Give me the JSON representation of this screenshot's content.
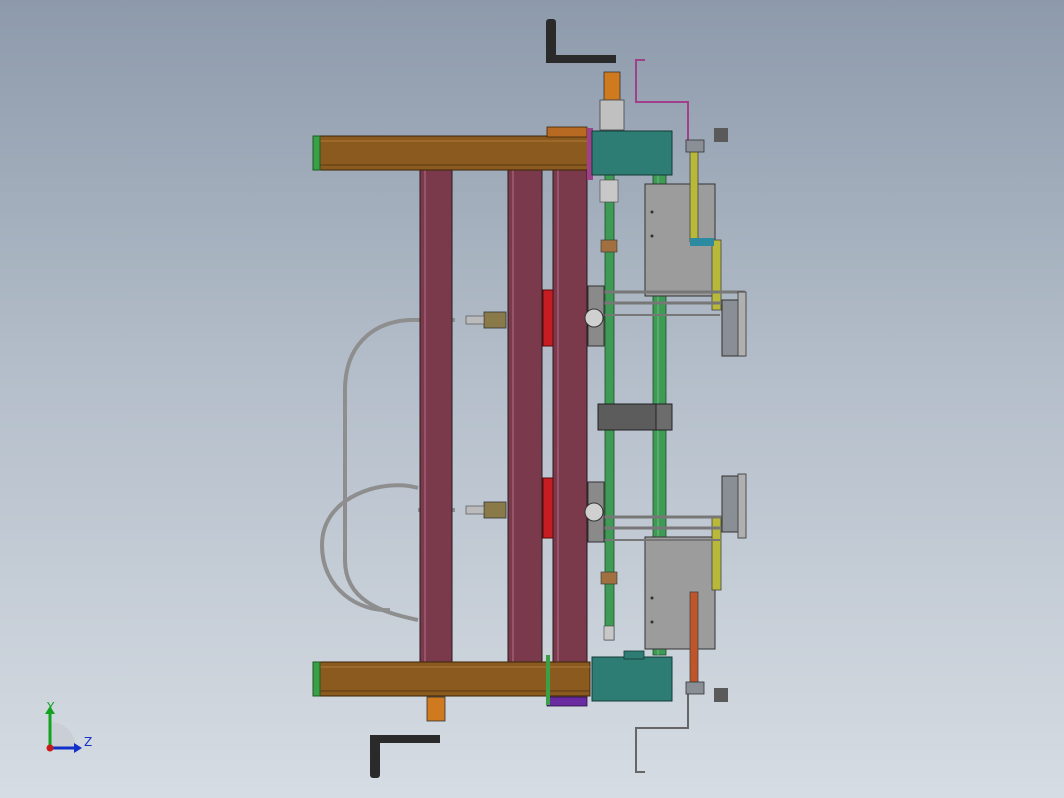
{
  "viewport": {
    "background_top": "#8d9aab",
    "background_bottom": "#d6dce3"
  },
  "colors": {
    "frame_beam": "#8b5a1f",
    "end_cap": "#3aa046",
    "vertical_post": "#7a3a4c",
    "teal_block": "#2e7d74",
    "green_rod": "#3f9a55",
    "grey_plate": "#9c9c9c",
    "red_gear": "#c41d22",
    "dark_handle": "#2a2a2a",
    "magenta_bracket": "#a0408a",
    "cable": "#9a9a9a"
  },
  "triad": {
    "y_label": "Y",
    "z_label": "Z",
    "y_color": "#12a31e",
    "z_color": "#1330c8",
    "x_color": "#c81a1a"
  }
}
